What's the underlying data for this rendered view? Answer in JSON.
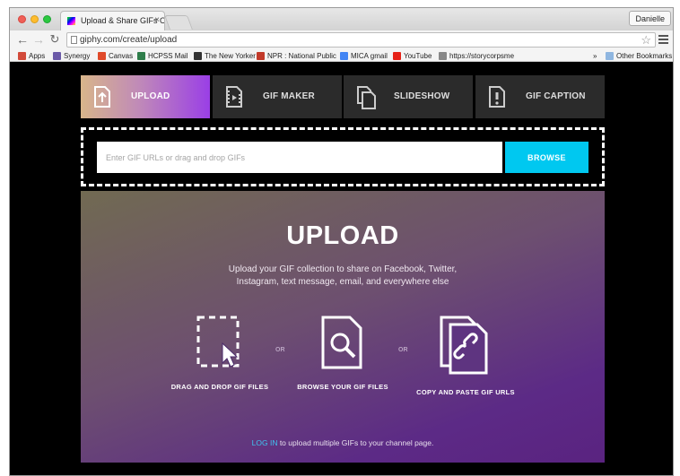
{
  "browser": {
    "tab_title": "Upload & Share GIFs Onlin",
    "tab_close": "×",
    "user_name": "Danielle",
    "url": "giphy.com/create/upload",
    "star": "☆"
  },
  "bookmarks": [
    {
      "label": "Apps",
      "icon": "apps-grid-icon",
      "color": "#d24a3a"
    },
    {
      "label": "Synergy",
      "icon": "synergy-icon",
      "color": "#6b5aa8"
    },
    {
      "label": "Canvas",
      "icon": "canvas-icon",
      "color": "#e04a2a"
    },
    {
      "label": "HCPSS Mail",
      "icon": "hcpss-mail-icon",
      "color": "#2e7d4a"
    },
    {
      "label": "The New Yorker",
      "icon": "new-yorker-icon",
      "color": "#333333"
    },
    {
      "label": "NPR : National Public",
      "icon": "npr-icon",
      "color": "#c23a2a"
    },
    {
      "label": "MICA gmail",
      "icon": "google-icon",
      "color": "#4285f4"
    },
    {
      "label": "YouTube",
      "icon": "youtube-icon",
      "color": "#e62117"
    },
    {
      "label": "https://storycorpsme",
      "icon": "page-icon",
      "color": "#888888"
    }
  ],
  "bookmarks_overflow": "»",
  "other_bookmarks": "Other Bookmarks",
  "mode_tabs": [
    {
      "label": "UPLOAD",
      "icon": "upload-file-icon",
      "active": true
    },
    {
      "label": "GIF MAKER",
      "icon": "film-file-icon",
      "active": false
    },
    {
      "label": "SLIDESHOW",
      "icon": "stacked-files-icon",
      "active": false
    },
    {
      "label": "GIF CAPTION",
      "icon": "caption-file-icon",
      "active": false
    }
  ],
  "dropzone": {
    "placeholder": "Enter GIF URLs or drag and drop GIFs",
    "browse_label": "BROWSE"
  },
  "panel": {
    "title": "UPLOAD",
    "description": "Upload your GIF collection to share on Facebook, Twitter, Instagram, text message, email, and everywhere else",
    "options": [
      {
        "label": "DRAG AND DROP GIF FILES",
        "icon": "drag-drop-icon"
      },
      {
        "label": "BROWSE YOUR GIF FILES",
        "icon": "browse-files-icon"
      },
      {
        "label": "COPY AND PASTE GIF URLS",
        "icon": "link-files-icon"
      }
    ],
    "or_label": "OR",
    "footer_link": "LOG IN",
    "footer_text": " to upload multiple GIFs to your channel page."
  },
  "colors": {
    "accent_cyan": "#00c8f0",
    "panel_purple": "#5c2a86",
    "tab_dark": "#2b2b2b"
  }
}
